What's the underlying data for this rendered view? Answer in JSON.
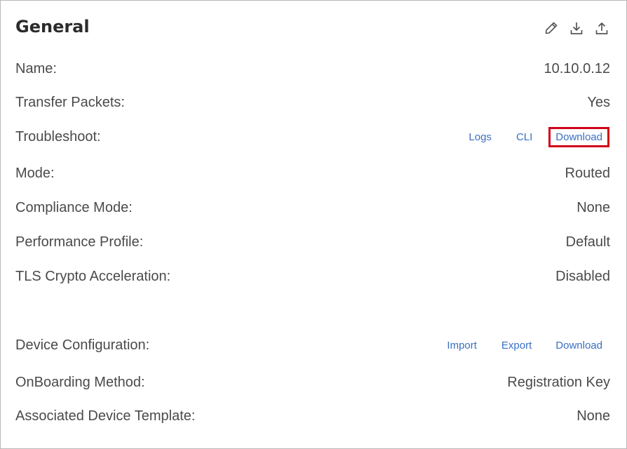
{
  "header": {
    "title": "General",
    "icons": [
      "edit-icon",
      "download-icon",
      "upload-icon"
    ]
  },
  "fields": {
    "name": {
      "label": "Name:",
      "value": "10.10.0.12"
    },
    "transfer_packets": {
      "label": "Transfer Packets:",
      "value": "Yes"
    },
    "troubleshoot": {
      "label": "Troubleshoot:",
      "links": {
        "logs": "Logs",
        "cli": "CLI",
        "download": "Download"
      }
    },
    "mode": {
      "label": "Mode:",
      "value": "Routed"
    },
    "compliance_mode": {
      "label": "Compliance Mode:",
      "value": "None"
    },
    "performance_profile": {
      "label": "Performance Profile:",
      "value": "Default"
    },
    "tls_crypto": {
      "label": "TLS Crypto Acceleration:",
      "value": "Disabled"
    },
    "device_configuration": {
      "label": "Device Configuration:",
      "links": {
        "import": "Import",
        "export": "Export",
        "download": "Download"
      }
    },
    "onboarding_method": {
      "label": "OnBoarding Method:",
      "value": "Registration Key"
    },
    "associated_template": {
      "label": "Associated Device Template:",
      "value": "None"
    }
  },
  "colors": {
    "link": "#3a6fc4",
    "highlight": "#d0021b",
    "text": "#4a4a4a",
    "title": "#2b2b2b"
  }
}
